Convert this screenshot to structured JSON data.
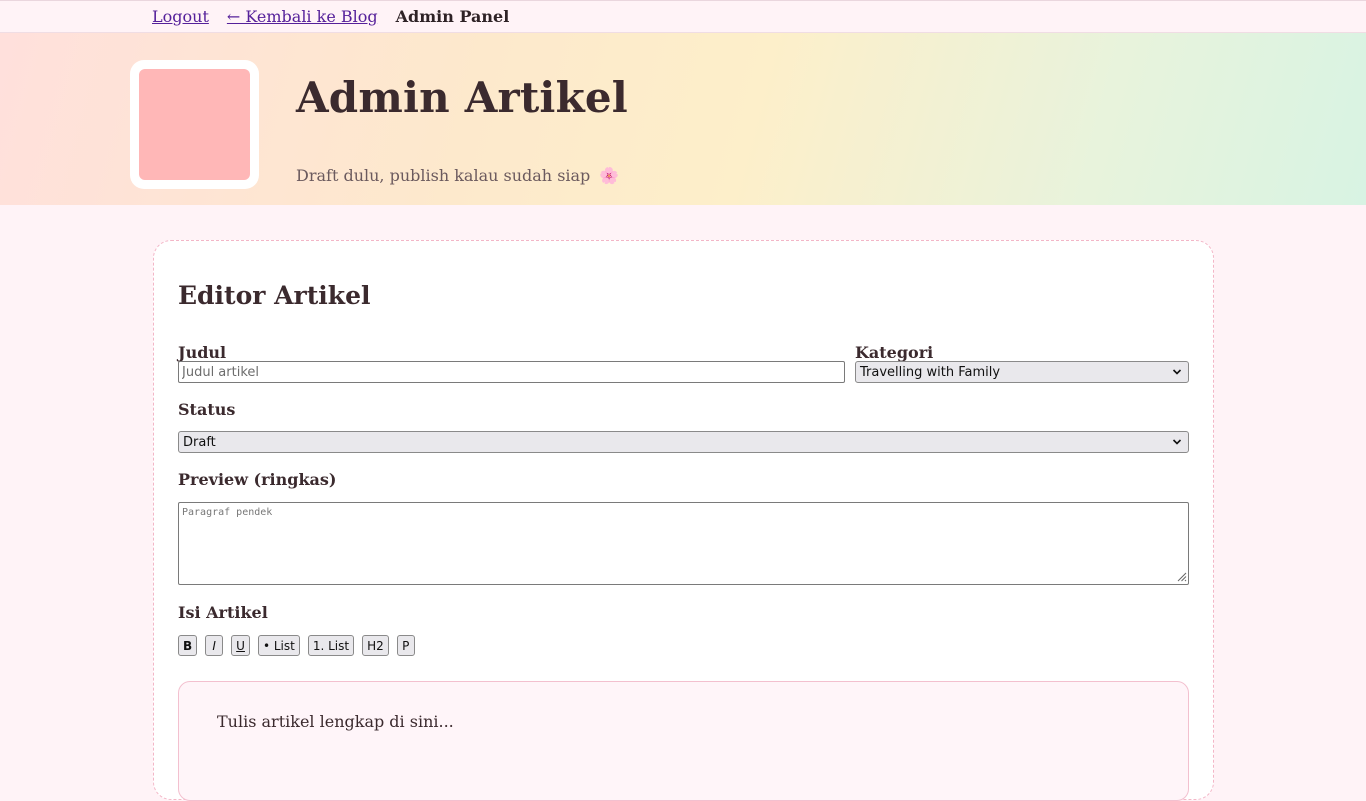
{
  "nav": {
    "logout": "Logout",
    "back_to_blog": "← Kembali ke Blog",
    "panel": "Admin Panel"
  },
  "hero": {
    "title": "Admin Artikel",
    "subtitle": "Draft dulu, publish kalau sudah siap",
    "subtitle_icon": "🌸"
  },
  "editor": {
    "heading": "Editor Artikel",
    "title_label": "Judul",
    "title_placeholder": "Judul artikel",
    "title_value": "",
    "category_label": "Kategori",
    "category_selected": "Travelling with Family",
    "status_label": "Status",
    "status_selected": "Draft",
    "preview_label": "Preview (ringkas)",
    "preview_placeholder": "Paragraf pendek",
    "content_label": "Isi Artikel",
    "content_placeholder": "Tulis artikel lengkap di sini...",
    "toolbar": {
      "bold": "B",
      "italic": "I",
      "underline": "U",
      "bullet_list": "• List",
      "numbered_list": "1. List",
      "h2": "H2",
      "paragraph": "P"
    }
  },
  "colors": {
    "accent_link": "#55209a",
    "logo_fill": "#ffb7b7",
    "card_border": "#f3b6c7",
    "page_bg": "#fff3f7"
  }
}
